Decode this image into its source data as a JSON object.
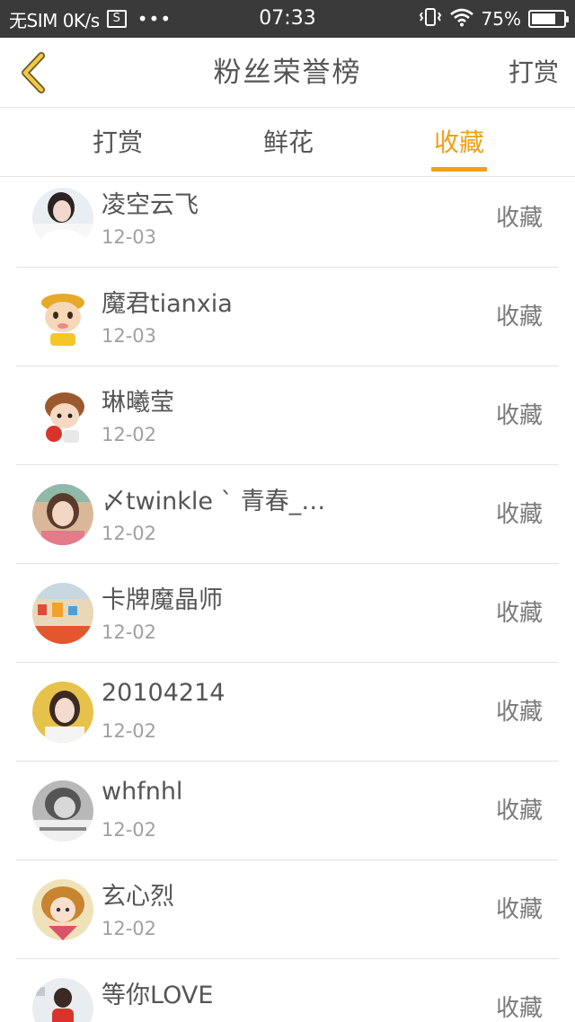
{
  "status_bar": {
    "carrier": "无SIM 0K/s",
    "sim_icon_text": "S",
    "dots": "•••",
    "time": "07:33",
    "battery": "75%",
    "battery_level": 0.75
  },
  "header": {
    "title": "粉丝荣誉榜",
    "action_label": "打赏"
  },
  "tabs": [
    {
      "label": "打赏",
      "active": false
    },
    {
      "label": "鲜花",
      "active": false
    },
    {
      "label": "收藏",
      "active": true
    }
  ],
  "colors": {
    "accent": "#f0a01a",
    "text": "#555555",
    "muted": "#a0a0a0",
    "status_bar": "#3a3a3a"
  },
  "rows": [
    {
      "name": "凌空云飞",
      "date": "12-03",
      "action": "收藏",
      "avatar": "girl-photo-avatar"
    },
    {
      "name": "魔君tianxia",
      "date": "12-03",
      "action": "收藏",
      "avatar": "monkey-king-cartoon-avatar"
    },
    {
      "name": "琳曦莹",
      "date": "12-02",
      "action": "收藏",
      "avatar": "cartoon-boy-avatar"
    },
    {
      "name": "〆twinkle ˋ 青春_…",
      "date": "12-02",
      "action": "收藏",
      "avatar": "girl-selfie-avatar"
    },
    {
      "name": "卡牌魔晶师",
      "date": "12-02",
      "action": "收藏",
      "avatar": "street-scene-avatar"
    },
    {
      "name": "20104214",
      "date": "12-02",
      "action": "收藏",
      "avatar": "girl-portrait-avatar"
    },
    {
      "name": "whfnhl",
      "date": "12-02",
      "action": "收藏",
      "avatar": "grayscale-photo-avatar"
    },
    {
      "name": "玄心烈",
      "date": "12-02",
      "action": "收藏",
      "avatar": "anime-girl-avatar"
    },
    {
      "name": "等你LOVE",
      "date": "",
      "action": "收藏",
      "avatar": "red-figure-avatar"
    }
  ]
}
